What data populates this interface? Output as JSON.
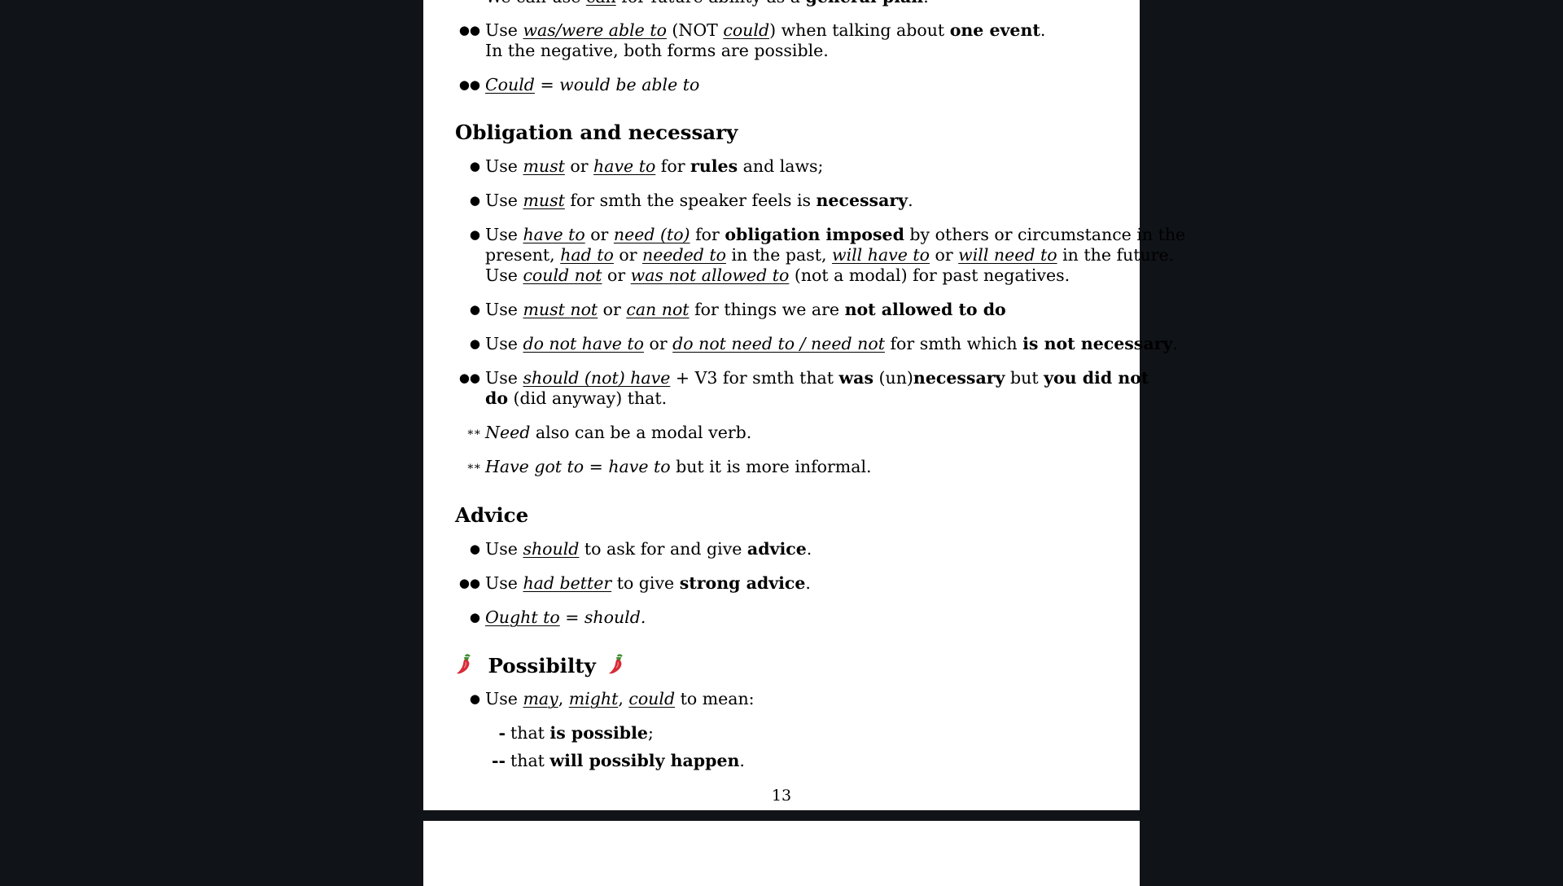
{
  "page1": {
    "top_fragment": {
      "c1": "We can use ",
      "c2": "can",
      "c3": " for future ability as a ",
      "c4": "general plan",
      "c5": "."
    },
    "ability_items": [
      {
        "marker": "●●",
        "a": "Use ",
        "b": "was/were able to",
        "c": " (NOT ",
        "d": "could",
        "e": ") when talking about ",
        "f": "one event",
        "g": ".",
        "line2": "In the negative, both forms are possible."
      },
      {
        "marker": "●●",
        "a": "Could",
        "b": " = ",
        "c": "would be able to"
      }
    ],
    "obligation": {
      "heading": "Obligation and necessary",
      "i1": {
        "marker": "●",
        "a": "Use ",
        "b": "must",
        "c": " or ",
        "d": "have to",
        "e": " for ",
        "f": "rules",
        "g": " and laws;"
      },
      "i2": {
        "marker": "●",
        "a": "Use ",
        "b": "must",
        "c": " for smth the speaker feels is ",
        "d": "necessary",
        "e": "."
      },
      "i3": {
        "marker": "●",
        "l1a": "Use ",
        "l1b": "have to",
        "l1c": " or ",
        "l1d": "need (to)",
        "l1e": " for ",
        "l1f": "obligation imposed",
        "l1g": " by others or circumstance in the",
        "l2a": "present, ",
        "l2b": "had to",
        "l2c": " or ",
        "l2d": "needed to",
        "l2e": " in the past, ",
        "l2f": "will have to",
        "l2g": " or ",
        "l2h": "will need to",
        "l2i": " in the future.",
        "l3a": "Use ",
        "l3b": "could not",
        "l3c": " or ",
        "l3d": "was not allowed to",
        "l3e": " (not a modal) for past negatives."
      },
      "i4": {
        "marker": "●",
        "a": "Use ",
        "b": "must not",
        "c": " or ",
        "d": "can not",
        "e": " for things we are ",
        "f": "not allowed to do"
      },
      "i5": {
        "marker": "●",
        "a": "Use ",
        "b": "do not have to",
        "c": " or ",
        "d": "do not need to / need not",
        "e": " for smth which ",
        "f": "is not necessary",
        "g": "."
      },
      "i6": {
        "marker": "●●",
        "l1a": "Use ",
        "l1b": "should (not) have",
        "l1c": " + V3 for smth that ",
        "l1d": "was",
        "l1e": " (un)",
        "l1f": "necessary",
        "l1g": " but ",
        "l1h": "you did not",
        "l2a": "do",
        "l2b": " (did anyway) that."
      },
      "i7": {
        "marker": "∗∗",
        "a": "Need",
        "b": " also can be a modal verb."
      },
      "i8": {
        "marker": "∗∗",
        "a": "Have got to",
        "b": " = ",
        "c": "have to",
        "d": " but it is more informal."
      }
    },
    "advice": {
      "heading": "Advice",
      "i1": {
        "marker": "●",
        "a": "Use ",
        "b": "should",
        "c": " to ask for and give ",
        "d": "advice",
        "e": "."
      },
      "i2": {
        "marker": "●●",
        "a": "Use ",
        "b": "had better",
        "c": " to give ",
        "d": "strong advice",
        "e": "."
      },
      "i3": {
        "marker": "●",
        "a": "Ought to",
        "b": " = ",
        "c": "should."
      }
    },
    "possibility": {
      "heading": "Possibilty",
      "icon": "chili-pepper-icon",
      "i1": {
        "marker": "●",
        "a": "Use ",
        "b": "may",
        "c": ", ",
        "d": "might",
        "e": ", ",
        "f": "could",
        "g": " to mean:"
      },
      "s1": {
        "marker": "-",
        "a": "that ",
        "b": "is possible",
        "c": ";"
      },
      "s2": {
        "marker": "--",
        "a": "that ",
        "b": "will possibly happen",
        "c": "."
      }
    },
    "page_number": "13"
  },
  "colors": {
    "background": "#101317",
    "page": "#ffffff",
    "chili_red": "#d62b38",
    "chili_green": "#3e8e2e"
  }
}
